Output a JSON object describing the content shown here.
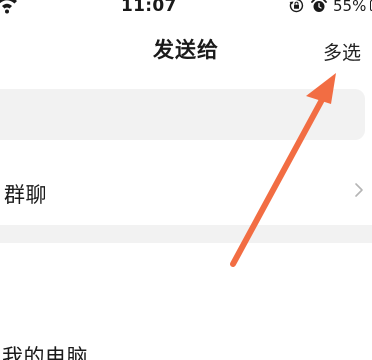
{
  "status_bar": {
    "time": "11:07",
    "battery_text": "55%",
    "icons": [
      "wifi-icon",
      "rotation-lock-icon",
      "alarm-icon",
      "battery-icon"
    ]
  },
  "nav": {
    "title": "发送给",
    "multi_select_label": "多选"
  },
  "search": {
    "placeholder": ""
  },
  "list": {
    "group_chat_label": "群聊",
    "my_computer_label": "我的电脑"
  },
  "annotation": {
    "arrow_color": "#f26d43",
    "points_to": "multi-select-button"
  },
  "colors": {
    "background": "#ffffff",
    "search_bg": "#f2f2f2",
    "text": "#1a1a1a",
    "chevron": "#b5b5b5"
  }
}
